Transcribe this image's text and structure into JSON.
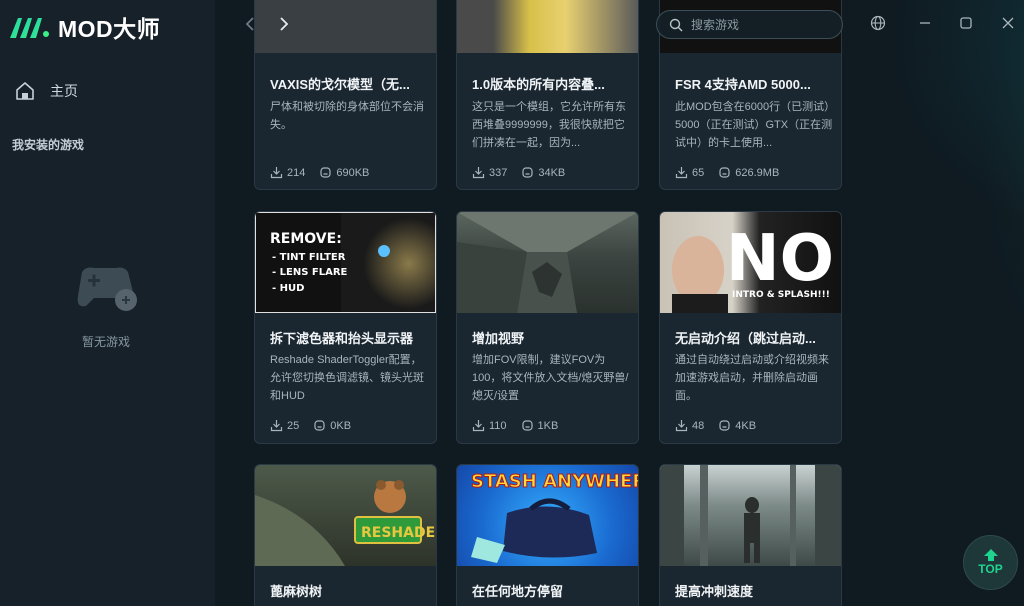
{
  "app": {
    "name": "MOD大师"
  },
  "sidebar": {
    "home_label": "主页",
    "section_title": "我安装的游戏",
    "empty_label": "暂无游戏"
  },
  "search": {
    "placeholder": "搜索游戏"
  },
  "top_button": {
    "label": "TOP"
  },
  "cards": [
    {
      "title": "VAXIS的戈尔模型（无...",
      "desc": "尸体和被切除的身体部位不会消失。",
      "downloads": "214",
      "size": "690KB"
    },
    {
      "title": "1.0版本的所有内容叠...",
      "desc": "这只是一个模组，它允许所有东西堆叠9999999，我很快就把它们拼凑在一起，因为...",
      "downloads": "337",
      "size": "34KB"
    },
    {
      "title": "FSR 4支持AMD 5000...",
      "desc": "此MOD包含在6000行（已测试）5000（正在测试）GTX（正在测试中）的卡上使用...",
      "downloads": "65",
      "size": "626.9MB"
    },
    {
      "title": "拆下滤色器和抬头显示器",
      "desc": "Reshade ShaderToggler配置，允许您切换色调滤镜、镜头光斑和HUD",
      "downloads": "25",
      "size": "0KB",
      "thumb_text": [
        "REMOVE:",
        "- TINT FILTER",
        "- LENS FLARE",
        "- HUD"
      ]
    },
    {
      "title": "增加视野",
      "desc": "增加FOV限制，建议FOV为100，将文件放入文档/熄灭野兽/熄灭/设置",
      "downloads": "110",
      "size": "1KB"
    },
    {
      "title": "无启动介绍（跳过启动...",
      "desc": "通过自动绕过启动或介绍视频来加速游戏启动，并删除启动画面。",
      "downloads": "48",
      "size": "4KB",
      "thumb_text": [
        "NO",
        "INTRO & SPLASH!!!"
      ]
    },
    {
      "title": "蓖麻树树",
      "thumb_text": [
        "RESHADE"
      ]
    },
    {
      "title": "在任何地方停留",
      "thumb_text": [
        "STASH ANYWHERE"
      ]
    },
    {
      "title": "提高冲刺速度"
    }
  ],
  "colors": {
    "accent": "#1fd48f",
    "logo_gradient_start": "#19d3a6",
    "logo_gradient_end": "#3ff08f"
  }
}
